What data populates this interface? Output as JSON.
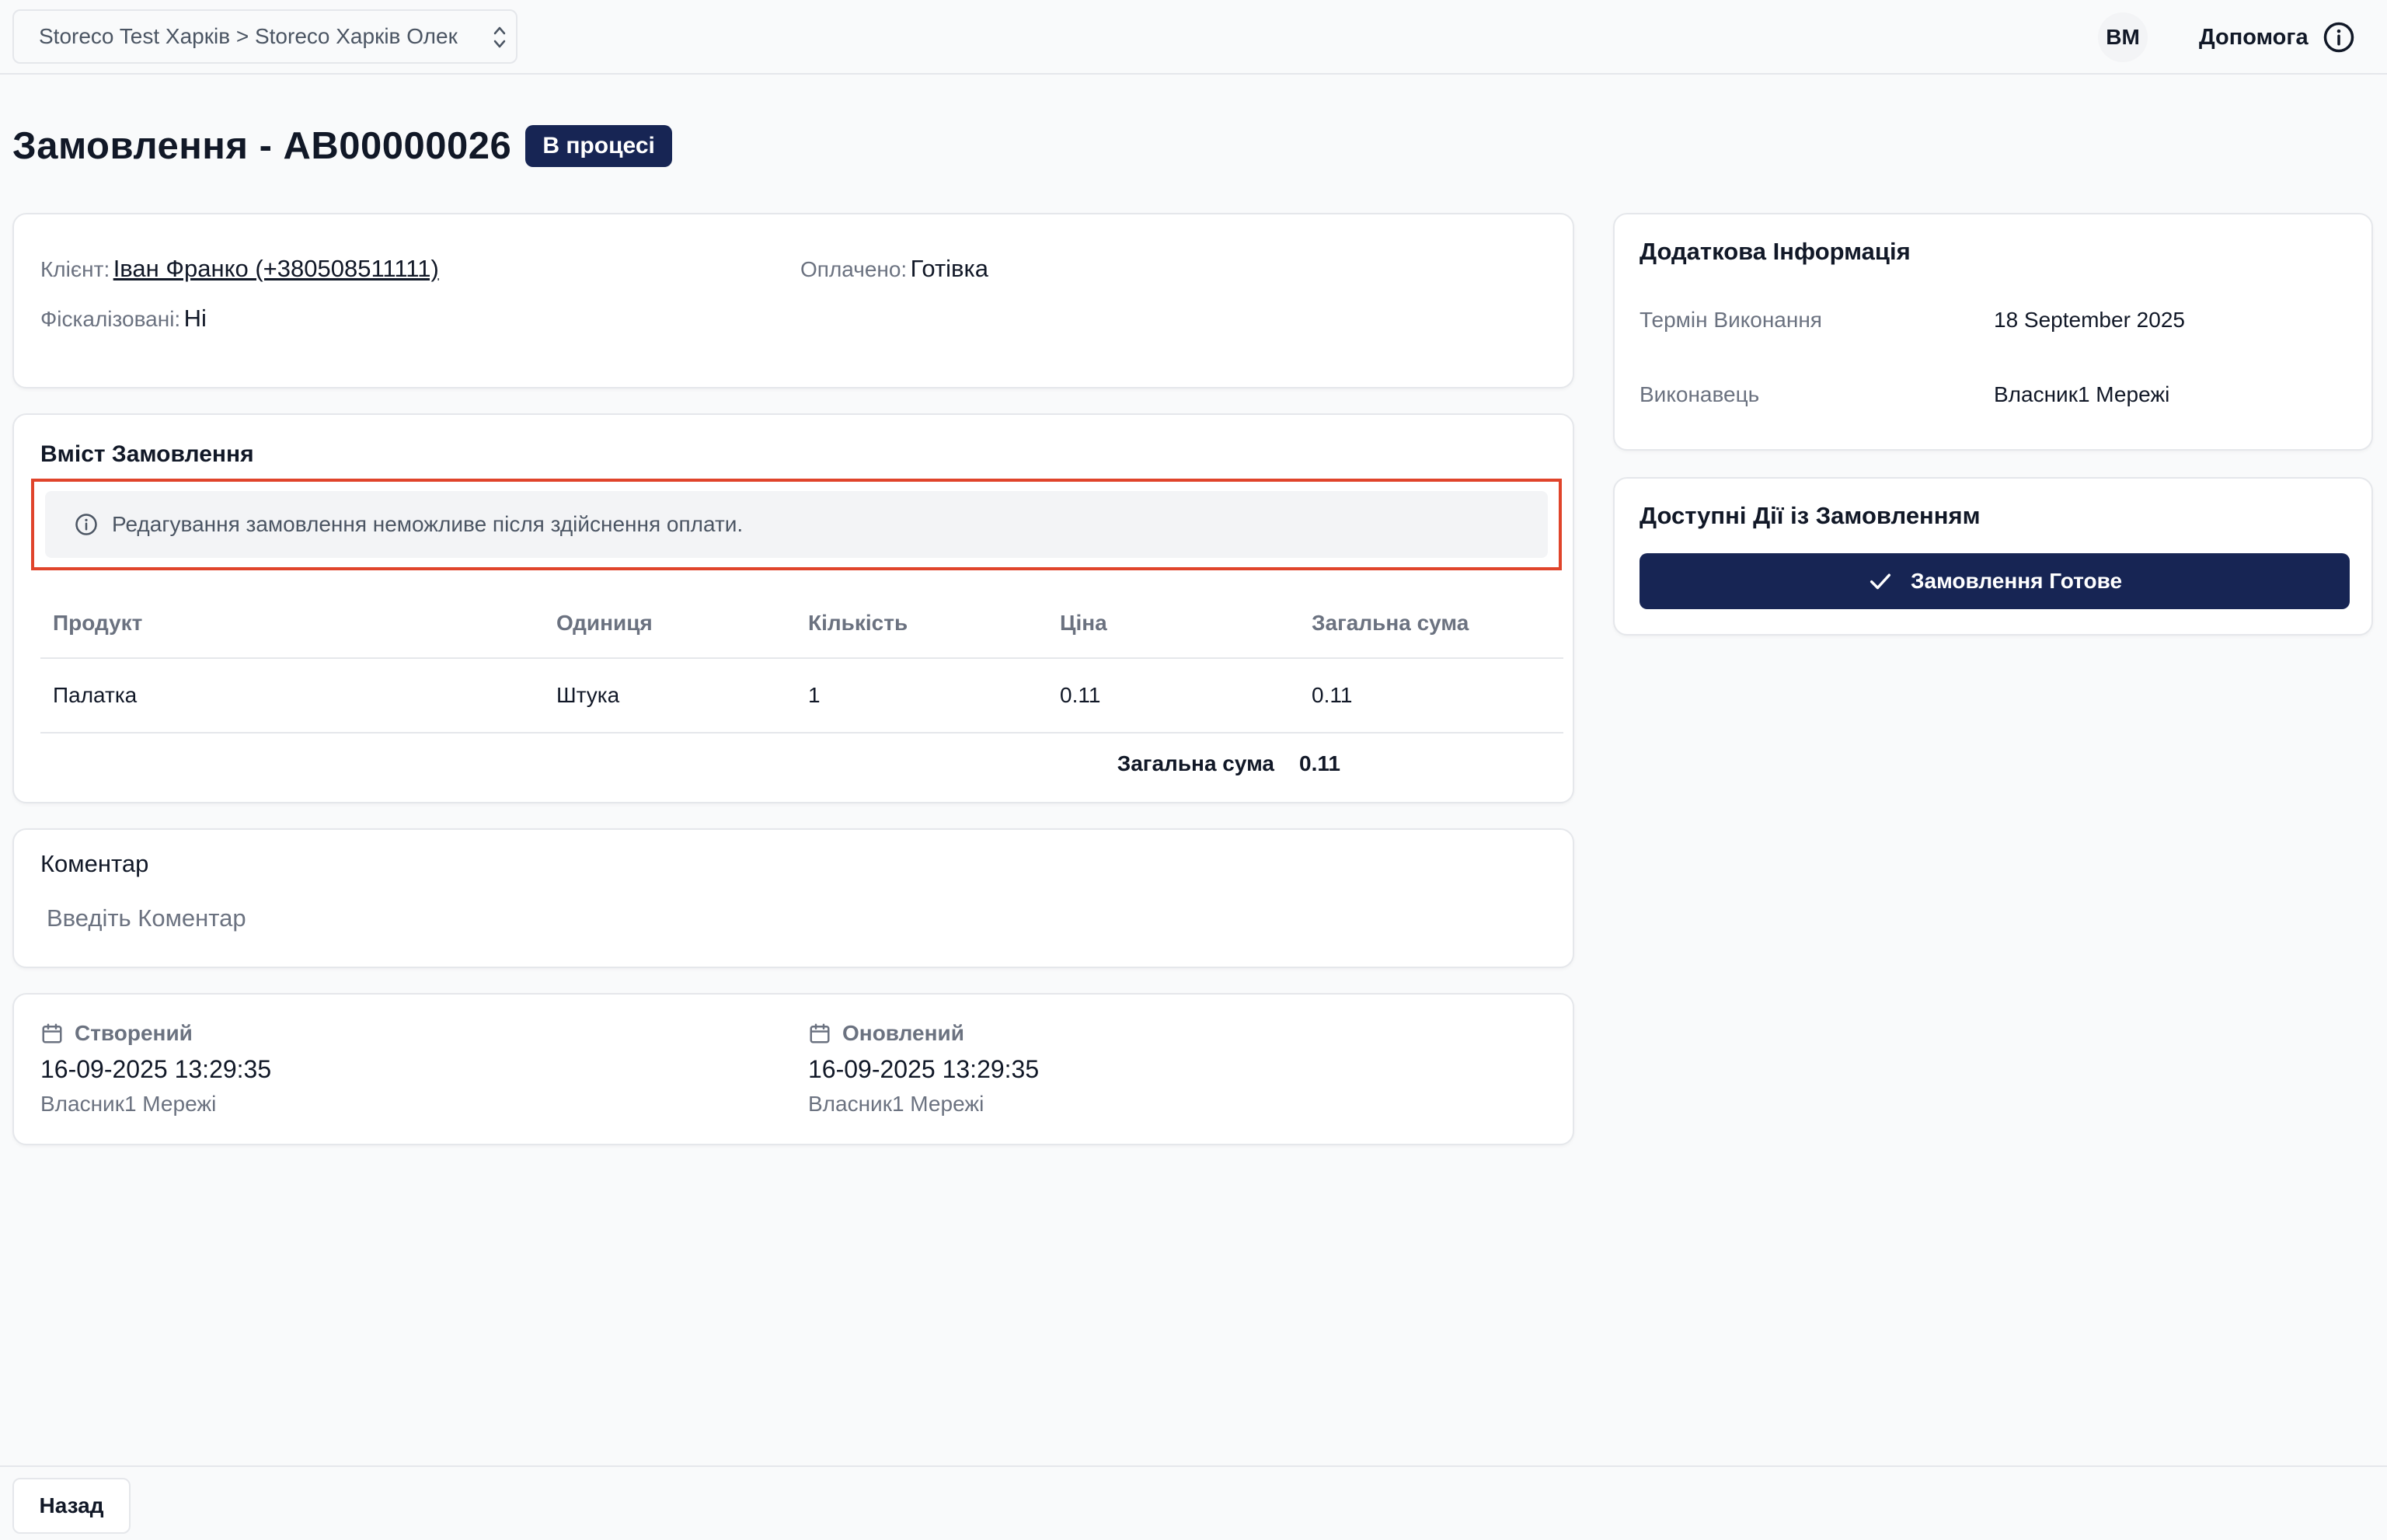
{
  "header": {
    "store_selector": "Storeco Test Харків > Storeco Харків Олек",
    "avatar_initials": "ВМ",
    "help_label": "Допомога"
  },
  "page": {
    "title": "Замовлення - AB00000026",
    "status_badge": "В процесі"
  },
  "client_card": {
    "client_label": "Клієнт:",
    "client_value": "Іван Франко (+380508511111)",
    "fiscal_label": "Фіскалізовані:",
    "fiscal_value": "Ні",
    "paid_label": "Оплачено:",
    "paid_value": "Готівка"
  },
  "order_content": {
    "title": "Вміст Замовлення",
    "alert": "Редагування замовлення неможливе після здійснення оплати.",
    "columns": [
      "Продукт",
      "Одиниця",
      "Кількість",
      "Ціна",
      "Загальна сума"
    ],
    "rows": [
      [
        "Палатка",
        "Штука",
        "1",
        "0.11",
        "0.11"
      ]
    ],
    "total_label": "Загальна сума",
    "total_value": "0.11"
  },
  "comment": {
    "title": "Коментар",
    "placeholder": "Введіть Коментар"
  },
  "timestamps": {
    "created_label": "Створений",
    "created_date": "16-09-2025 13:29:35",
    "created_by": "Власник1 Мережі",
    "updated_label": "Оновлений",
    "updated_date": "16-09-2025 13:29:35",
    "updated_by": "Власник1 Мережі"
  },
  "extra_info": {
    "title": "Додаткова Інформація",
    "deadline_label": "Термін Виконання",
    "deadline_value": "18 September 2025",
    "executor_label": "Виконавець",
    "executor_value": "Власник1 Мережі"
  },
  "actions": {
    "title": "Доступні Дії із Замовленням",
    "ready_button": "Замовлення Готове"
  },
  "footer": {
    "back_button": "Назад"
  },
  "colors": {
    "primary": "#172554",
    "alert_outline": "#e0442b",
    "muted_text": "#6b7280"
  }
}
